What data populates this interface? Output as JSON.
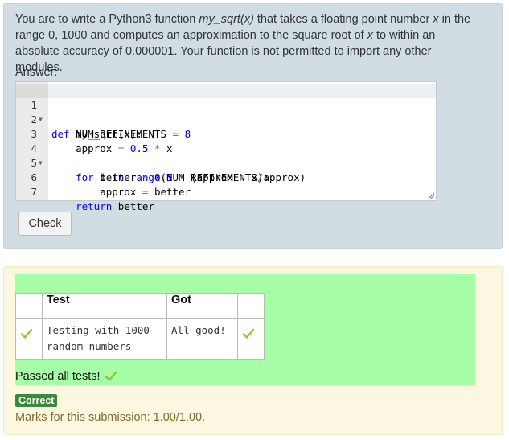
{
  "question": {
    "part1": "You are to write a Python3 function ",
    "func_name": "my_sqrt(x)",
    "part2": " that takes a floating point number ",
    "var_x": "x",
    "part3": " in the range 0, 1000 and computes an approximation to the square root of ",
    "var_x2": "x",
    "part4": " to within an absolute accuracy of 0.000001. Your function is not permitted to import any other modules."
  },
  "answer_label": "Answer:",
  "editor": {
    "lines": [
      {
        "n": "1",
        "fold": true
      },
      {
        "n": "2",
        "fold": false
      },
      {
        "n": "3",
        "fold": false
      },
      {
        "n": "4",
        "fold": true
      },
      {
        "n": "5",
        "fold": false
      },
      {
        "n": "6",
        "fold": false
      },
      {
        "n": "7",
        "fold": false
      }
    ],
    "code": {
      "l1": {
        "kw": "def",
        "rest": " my_sqrt(x):"
      },
      "l2": {
        "a": "    NUM_REFINEMENTS ",
        "op": "=",
        "num": " 8"
      },
      "l3": {
        "a": "    approx ",
        "op1": "=",
        "num": " 0.5",
        "op2": " *",
        "b": " x"
      },
      "l4": {
        "kw1": "    for",
        "a": " i ",
        "kw2": "in",
        "bi": " range",
        "b": "(NUM_REFINEMENTS):"
      },
      "l5": {
        "a": "        better ",
        "op1": "=",
        "num": " 0.5",
        "op2": " *",
        "b": " (approx ",
        "op3": "+",
        "c": " x",
        "op4": "/",
        "d": "approx)"
      },
      "l6": {
        "a": "        approx ",
        "op": "=",
        "b": " better"
      },
      "l7": {
        "kw": "    return",
        "b": " better"
      }
    }
  },
  "check_button": "Check",
  "results": {
    "headers": [
      "Test",
      "Got"
    ],
    "rows": [
      {
        "test": "Testing with 1000 random numbers",
        "got": "All good!"
      }
    ]
  },
  "passed_text": "Passed all tests!",
  "correct_badge": "Correct",
  "marks_text": "Marks for this submission: 1.00/1.00.",
  "colors": {
    "question_bg": "#d0dee3",
    "feedback_bg": "#fcf7e0",
    "pass_green": "#a6ffa6",
    "tick_green": "#8ec63f",
    "badge_green": "#3b8a3b"
  },
  "icons": {
    "tick": "check-mark-icon",
    "fold": "fold-arrow-icon",
    "grip": "resize-grip-icon"
  }
}
